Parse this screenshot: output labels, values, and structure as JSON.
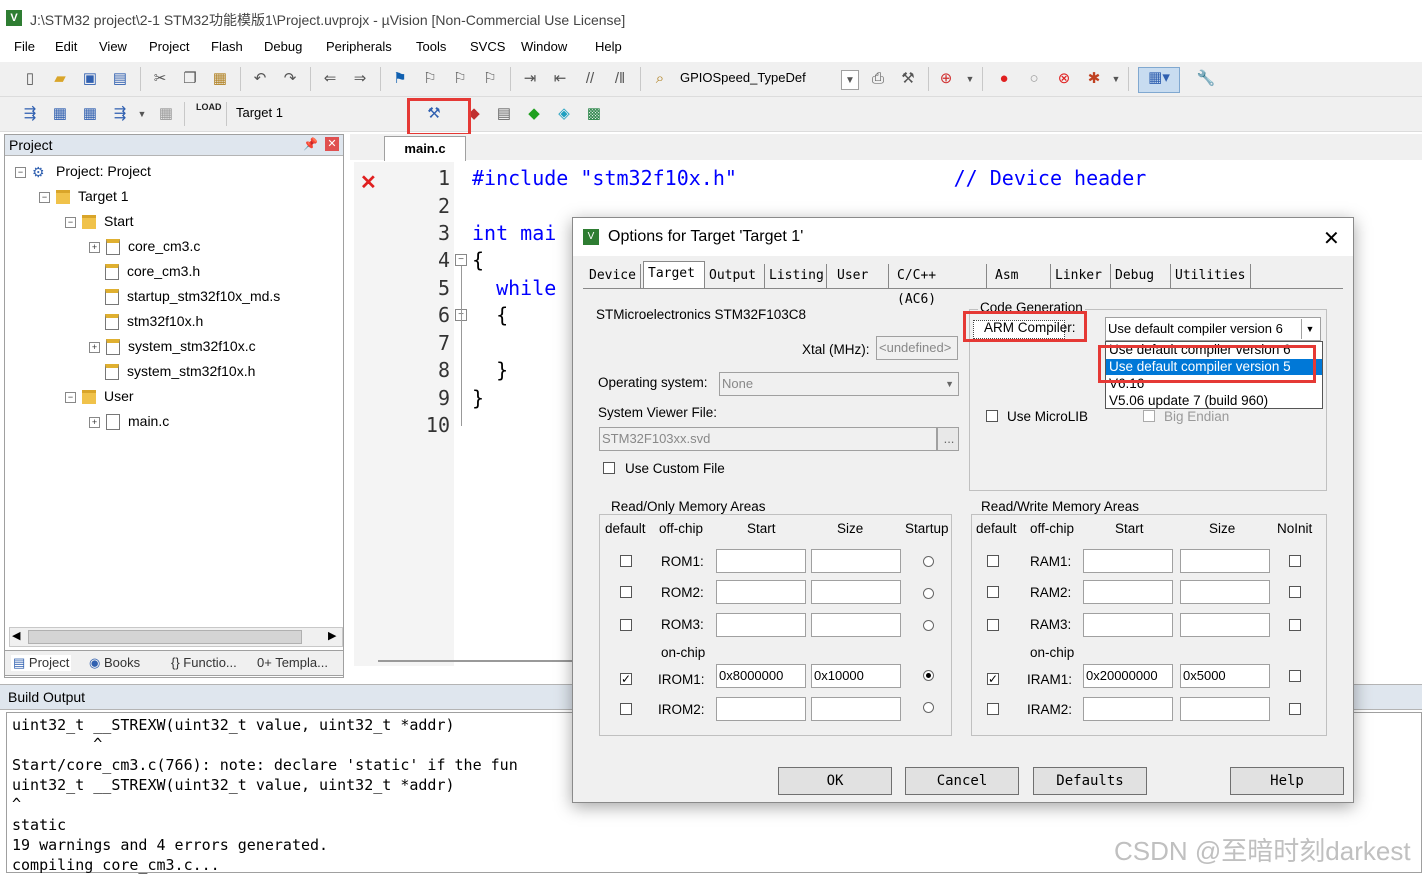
{
  "window": {
    "title": "J:\\STM32 project\\2-1 STM32功能模版1\\Project.uvprojx - µVision  [Non-Commercial Use License]"
  },
  "menu": [
    "File",
    "Edit",
    "View",
    "Project",
    "Flash",
    "Debug",
    "Peripherals",
    "Tools",
    "SVCS",
    "Window",
    "Help"
  ],
  "toolbar": {
    "find_combo": "GPIOSpeed_TypeDef",
    "target_combo": "Target 1",
    "load_label": "LOAD"
  },
  "project_panel": {
    "title": "Project",
    "tree": [
      "Project: Project",
      "Target 1",
      "Start",
      "core_cm3.c",
      "core_cm3.h",
      "startup_stm32f10x_md.s",
      "stm32f10x.h",
      "system_stm32f10x.c",
      "system_stm32f10x.h",
      "User",
      "main.c"
    ],
    "tabs": [
      "Project",
      "Books",
      "{} Functio...",
      "0+ Templa..."
    ]
  },
  "editor": {
    "tab": "main.c",
    "line_numbers": [
      "1",
      "2",
      "3",
      "4",
      "5",
      "6",
      "7",
      "8",
      "9",
      "10"
    ],
    "lines": [
      "#include \"stm32f10x.h\"                  // Device header",
      "",
      "int mai",
      "{",
      "  while",
      "  {",
      "",
      "  }",
      "}",
      ""
    ]
  },
  "build_output": {
    "title": "Build Output",
    "lines": [
      "uint32_t __STREXW(uint32_t value, uint32_t *addr)",
      "         ^",
      "Start/core_cm3.c(766): note: declare 'static' if the fun",
      "uint32_t __STREXW(uint32_t value, uint32_t *addr)",
      "^",
      "static",
      "19 warnings and 4 errors generated.",
      "compiling core_cm3.c..."
    ]
  },
  "dialog": {
    "title": "Options for Target 'Target 1'",
    "tabs": [
      "Device",
      "Target",
      "Output",
      "Listing",
      "User",
      "C/C++ (AC6)",
      "Asm",
      "Linker",
      "Debug",
      "Utilities"
    ],
    "active_tab": "Target",
    "device": "STMicroelectronics STM32F103C8",
    "xtal_label": "Xtal (MHz):",
    "xtal_value": "<undefined>",
    "os_label": "Operating system:",
    "os_value": "None",
    "svf_label": "System Viewer File:",
    "svf_value": "STM32F103xx.svd",
    "custom_file": "Use Custom File",
    "code_gen": "Code Generation",
    "arm_compiler": "ARM Compiler:",
    "compiler_selected": "Use default compiler version 6",
    "compiler_options": [
      "Use default compiler version 6",
      "Use default compiler version 5",
      "V6.16",
      "V5.06 update 7 (build 960)"
    ],
    "microlib": "Use MicroLIB",
    "big_endian": "Big Endian",
    "rom_group": "Read/Only Memory Areas",
    "ram_group": "Read/Write Memory Areas",
    "rom_headers": [
      "default",
      "off-chip",
      "Start",
      "Size",
      "Startup"
    ],
    "ram_headers": [
      "default",
      "off-chip",
      "Start",
      "Size",
      "NoInit"
    ],
    "on_chip": "on-chip",
    "rom_rows": [
      {
        "name": "ROM1:",
        "start": "",
        "size": ""
      },
      {
        "name": "ROM2:",
        "start": "",
        "size": ""
      },
      {
        "name": "ROM3:",
        "start": "",
        "size": ""
      },
      {
        "name": "IROM1:",
        "start": "0x8000000",
        "size": "0x10000"
      },
      {
        "name": "IROM2:",
        "start": "",
        "size": ""
      }
    ],
    "ram_rows": [
      {
        "name": "RAM1:",
        "start": "",
        "size": ""
      },
      {
        "name": "RAM2:",
        "start": "",
        "size": ""
      },
      {
        "name": "RAM3:",
        "start": "",
        "size": ""
      },
      {
        "name": "IRAM1:",
        "start": "0x20000000",
        "size": "0x5000"
      },
      {
        "name": "IRAM2:",
        "start": "",
        "size": ""
      }
    ],
    "buttons": [
      "OK",
      "Cancel",
      "Defaults",
      "Help"
    ]
  },
  "watermark": "CSDN @至暗时刻darkest",
  "colors": {
    "highlight_red": "#e53935",
    "selection_blue": "#0078d7",
    "keyword_blue": "#0000ff",
    "comment_green": "#008000"
  }
}
